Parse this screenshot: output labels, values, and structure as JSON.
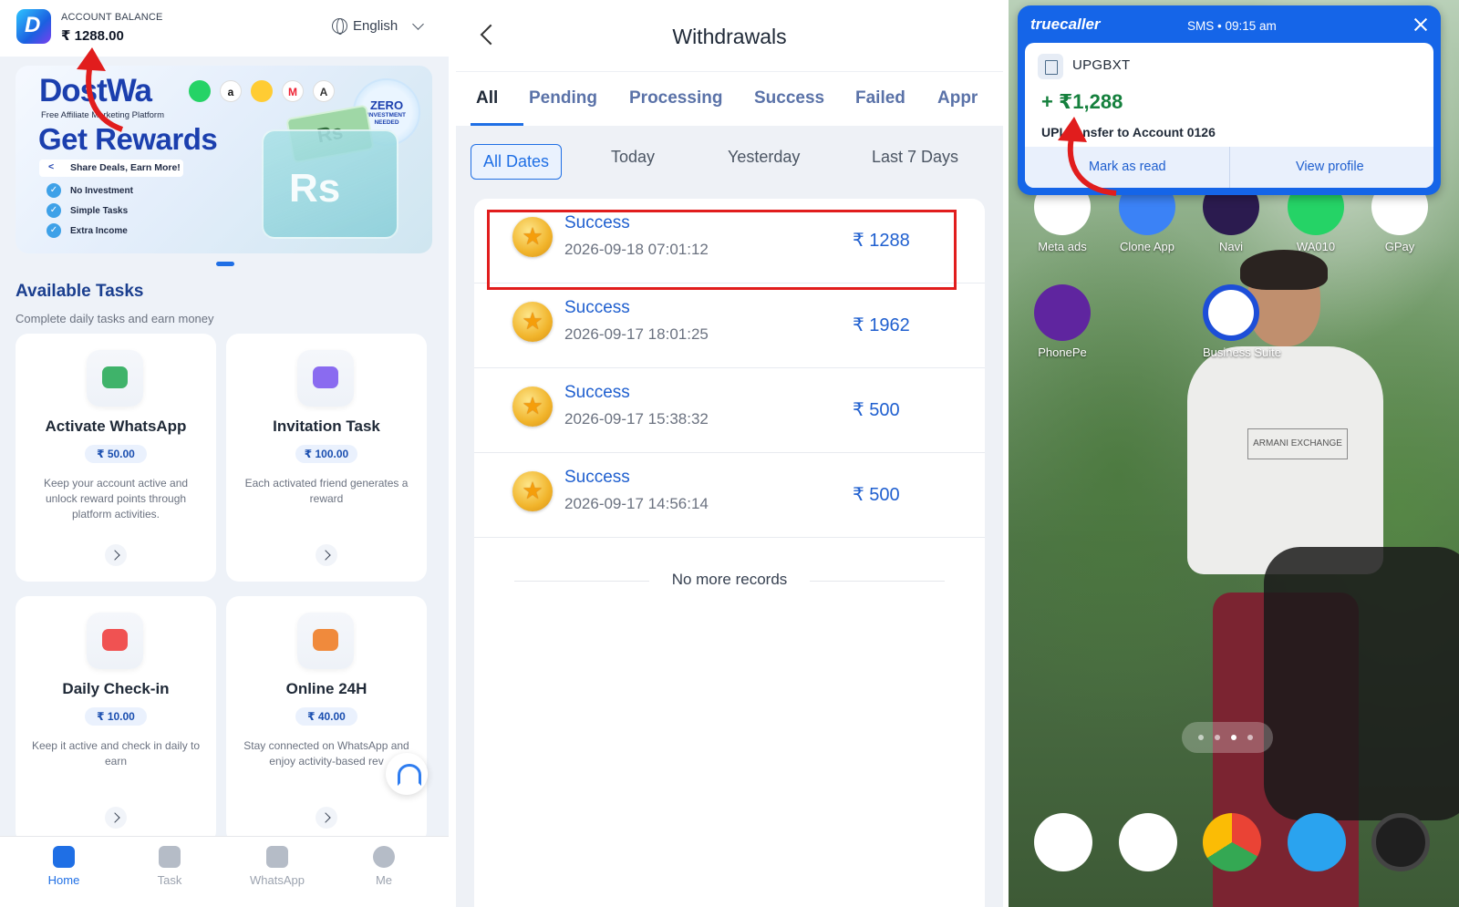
{
  "panel1": {
    "header": {
      "balance_label": "ACCOUNT BALANCE",
      "balance_value": "₹ 1288.00",
      "language": "English"
    },
    "banner": {
      "brand": "DostWa",
      "tagline": "Free Affiliate Marketing Platform",
      "headline": "Get Rewards",
      "share_text": "Share Deals, Earn More!",
      "features": [
        "No Investment",
        "Simple Tasks",
        "Extra Income"
      ],
      "badge_main": "ZERO",
      "badge_sub": "INVESTMENT NEEDED",
      "bill_text": "Rs"
    },
    "section": {
      "title": "Available Tasks",
      "subtitle": "Complete daily tasks and earn money"
    },
    "tasks": [
      {
        "title": "Activate WhatsApp",
        "reward": "₹ 50.00",
        "description": "Keep your account active and unlock reward points through platform activities.",
        "icon": "chat-icon",
        "icon_color": "#3fb36a"
      },
      {
        "title": "Invitation Task",
        "reward": "₹ 100.00",
        "description": "Each activated friend generates a reward",
        "icon": "user-icon",
        "icon_color": "#8a6bf0"
      },
      {
        "title": "Daily Check-in",
        "reward": "₹ 10.00",
        "description": "Keep it active and check in daily to earn",
        "icon": "calendar-icon",
        "icon_color": "#f05252"
      },
      {
        "title": "Online 24H",
        "reward": "₹ 40.00",
        "description": "Stay connected on WhatsApp and enjoy activity-based rev",
        "icon": "home-icon",
        "icon_color": "#f08a3c"
      }
    ],
    "nav": [
      {
        "label": "Home",
        "icon": "home-icon",
        "active": true
      },
      {
        "label": "Task",
        "icon": "task-icon",
        "active": false
      },
      {
        "label": "WhatsApp",
        "icon": "star-icon",
        "active": false
      },
      {
        "label": "Me",
        "icon": "face-icon",
        "active": false
      }
    ]
  },
  "panel2": {
    "title": "Withdrawals",
    "tabs": [
      "All",
      "Pending",
      "Processing",
      "Success",
      "Failed",
      "Appr"
    ],
    "active_tab": "All",
    "filters": [
      "All Dates",
      "Today",
      "Yesterday",
      "Last 7 Days"
    ],
    "active_filter": "All Dates",
    "records": [
      {
        "status": "Success",
        "datetime": "2026-09-18 07:01:12",
        "amount": "₹ 1288",
        "highlighted": true
      },
      {
        "status": "Success",
        "datetime": "2026-09-17 18:01:25",
        "amount": "₹ 1962",
        "highlighted": false
      },
      {
        "status": "Success",
        "datetime": "2026-09-17 15:38:32",
        "amount": "₹ 500",
        "highlighted": false
      },
      {
        "status": "Success",
        "datetime": "2026-09-17 14:56:14",
        "amount": "₹ 500",
        "highlighted": false
      }
    ],
    "footer_text": "No more records",
    "highlight_color": "#e11d1d"
  },
  "panel3": {
    "notification": {
      "app": "truecaller",
      "meta": "SMS • 09:15 am",
      "sender": "UPGBXT",
      "amount": "+ ₹1,288",
      "message": "UPI transfer to Account 0126",
      "action_1": "Mark as read",
      "action_2": "View profile"
    },
    "home_apps": [
      {
        "label": "Meta ads",
        "color": "#ffffff"
      },
      {
        "label": "Clone App",
        "color": "#3b82f6"
      },
      {
        "label": "Navi",
        "color": "#2b1b4f"
      },
      {
        "label": "WA010",
        "color": "#25d366"
      },
      {
        "label": "GPay",
        "color": "#ffffff"
      },
      {
        "label": "PhonePe",
        "color": "#5f259f"
      },
      {
        "label": "Business Suite",
        "color": "#ffffff"
      }
    ],
    "dock": [
      {
        "name": "phone-icon",
        "color": "#ffffff"
      },
      {
        "name": "messages-icon",
        "color": "#ffffff"
      },
      {
        "name": "chrome-icon",
        "color": "#ffffff"
      },
      {
        "name": "telegram-icon",
        "color": "#2aa3ef"
      },
      {
        "name": "camera-icon",
        "color": "#1f1f1f"
      }
    ],
    "shirt_text": "ARMANI EXCHANGE"
  }
}
